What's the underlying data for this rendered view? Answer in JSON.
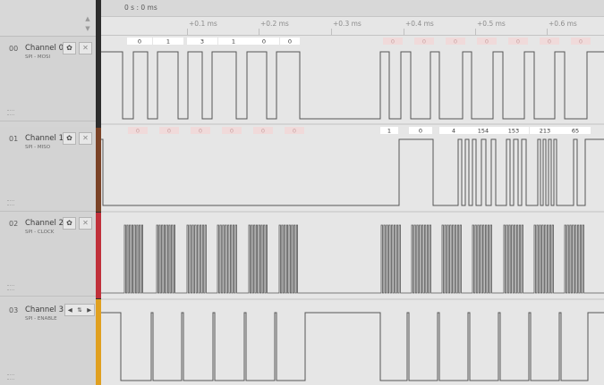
{
  "timeline": {
    "timestamp": "0 s : 0 ms",
    "ticks": [
      "+0.1 ms",
      "+0.2 ms",
      "+0.3 ms",
      "+0.4 ms",
      "+0.5 ms",
      "+0.6 ms"
    ]
  },
  "channels": [
    {
      "number": "00",
      "name": "Channel 0",
      "sublabel": "SPI - MOSI"
    },
    {
      "number": "01",
      "name": "Channel 1",
      "sublabel": "SPI - MISO"
    },
    {
      "number": "02",
      "name": "Channel 2",
      "sublabel": "SPI - CLOCK"
    },
    {
      "number": "03",
      "name": "Channel 3",
      "sublabel": "SPI - ENABLE"
    }
  ],
  "decoded": {
    "mosi_visible": [
      "0",
      "1",
      "3",
      "1",
      "0",
      "0"
    ],
    "mosi_faded": [
      "0",
      "0",
      "0",
      "0",
      "0",
      "0",
      "0"
    ],
    "miso_faded": [
      "0",
      "0",
      "0",
      "0",
      "0",
      "0"
    ],
    "miso_visible": [
      "1",
      "0",
      "4",
      "154",
      "153",
      "213",
      "65"
    ]
  },
  "colors": {
    "channel0": "#2b2b2b",
    "channel1": "#8a4a2a",
    "channel2": "#c0303a",
    "channel3": "#e0a020"
  }
}
